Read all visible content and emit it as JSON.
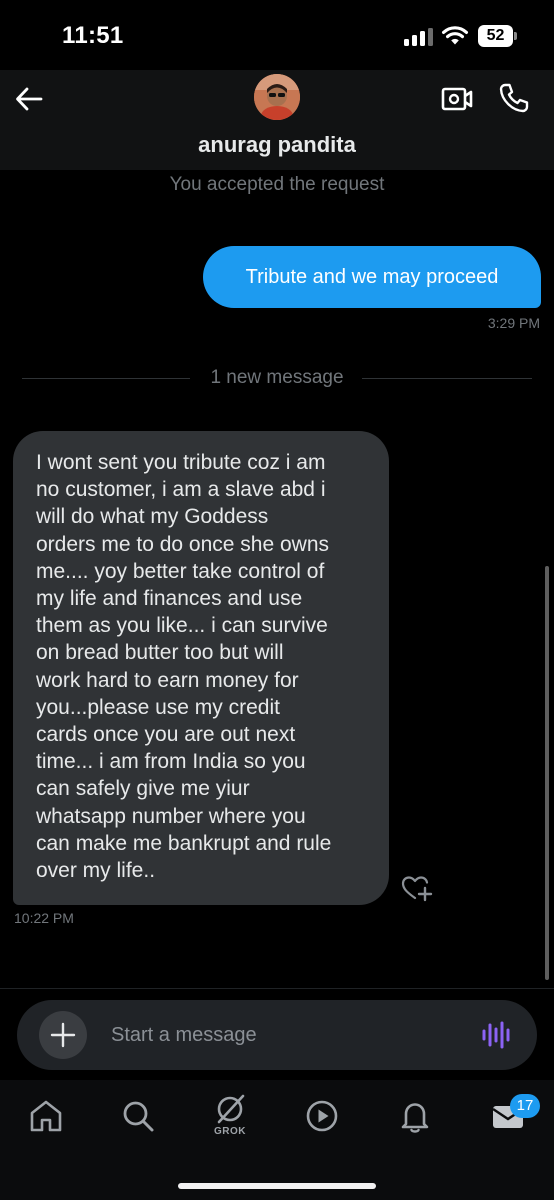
{
  "status_bar": {
    "time": "11:51",
    "battery_level": "52",
    "signal_icon": "cellular-signal-icon",
    "wifi_icon": "wifi-icon"
  },
  "header": {
    "back_icon": "arrow-left-icon",
    "contact_name": "anurag pandita",
    "video_call_icon": "video-camera-icon",
    "voice_call_icon": "phone-icon"
  },
  "conversation": {
    "system_note": "You accepted the request",
    "outgoing": {
      "text": "Tribute and we may proceed",
      "timestamp": "3:29 PM"
    },
    "unread_divider": "1 new message",
    "incoming": {
      "lines": [
        "I wont sent you tribute coz i am",
        "no customer, i am a slave abd i",
        "will do what my Goddess",
        "orders me to do once she owns",
        "me.... yoy better take control of",
        "my life and finances and use",
        "them as you like... i can survive",
        "on bread butter too but will",
        "work hard to earn money for",
        "you...please use my credit",
        "cards once you are out next",
        "time... i am from India so you",
        "can safely give me yiur",
        "whatsapp number where you",
        "can make me bankrupt and rule",
        "over my life.."
      ],
      "timestamp": "10:22 PM",
      "react_icon": "heart-plus-icon"
    }
  },
  "composer": {
    "add_icon": "plus-icon",
    "placeholder": "Start a message",
    "voice_icon": "voice-waveform-icon"
  },
  "tab_bar": {
    "items": [
      {
        "name": "home",
        "icon": "home-icon"
      },
      {
        "name": "search",
        "icon": "search-icon"
      },
      {
        "name": "grok",
        "icon": "grok-icon",
        "label": "GROK"
      },
      {
        "name": "video",
        "icon": "play-circle-icon"
      },
      {
        "name": "notifications",
        "icon": "bell-icon"
      },
      {
        "name": "messages",
        "icon": "envelope-icon",
        "badge": "17"
      }
    ]
  },
  "colors": {
    "background": "#000000",
    "header": "#111213",
    "outgoing_bubble": "#1d9bf0",
    "incoming_bubble": "#303336",
    "muted_text": "#71767b",
    "voice_icon": "#8c63f5"
  }
}
